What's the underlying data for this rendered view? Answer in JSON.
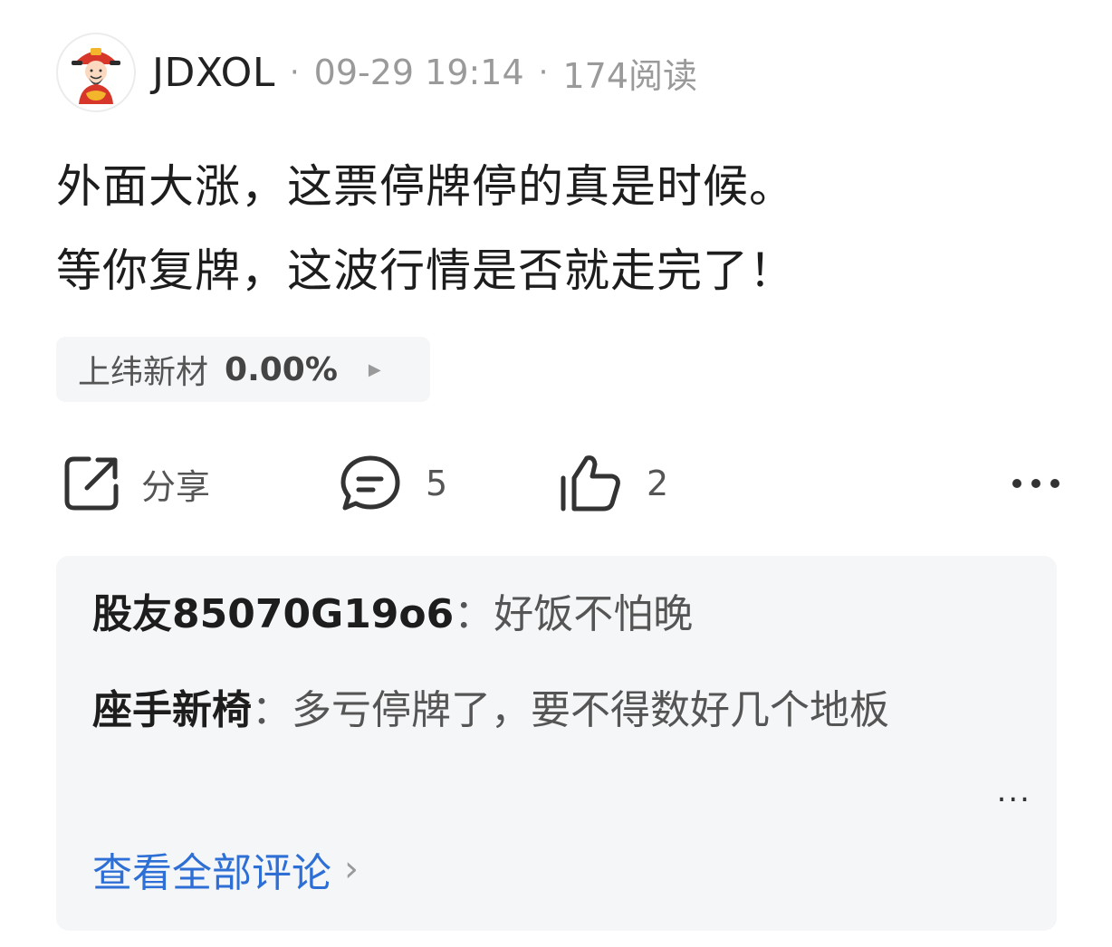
{
  "post": {
    "username": "JDXOL",
    "separator": "·",
    "timestamp": "09-29 19:14",
    "reads": "174阅读",
    "text_line1": "外面大涨，这票停牌停的真是时候。",
    "text_line2": "等你复牌，这波行情是否就走完了！"
  },
  "stock_tag": {
    "name": "上纬新材",
    "change": "0.00%"
  },
  "actions": {
    "share_label": "分享",
    "comment_count": "5",
    "like_count": "2"
  },
  "comments": {
    "items": [
      {
        "author": "股友85070G19o6",
        "colon": "：",
        "text": "好饭不怕晚"
      },
      {
        "author": "座手新椅",
        "colon": "：",
        "text": "多亏停牌了，要不得数好几个地板"
      }
    ],
    "view_all_label": "查看全部评论",
    "more_glyph": "..."
  },
  "colors": {
    "text": "#1d1d1d",
    "meta": "#9a9a9a",
    "panel": "#f5f6f8",
    "link": "#2e6fd6",
    "avatar_red": "#d7362b",
    "avatar_gold": "#f2b52c"
  },
  "icons": [
    "avatar-fortune-god",
    "share-icon",
    "comment-icon",
    "like-icon",
    "more-icon",
    "chevron-right-icon"
  ]
}
